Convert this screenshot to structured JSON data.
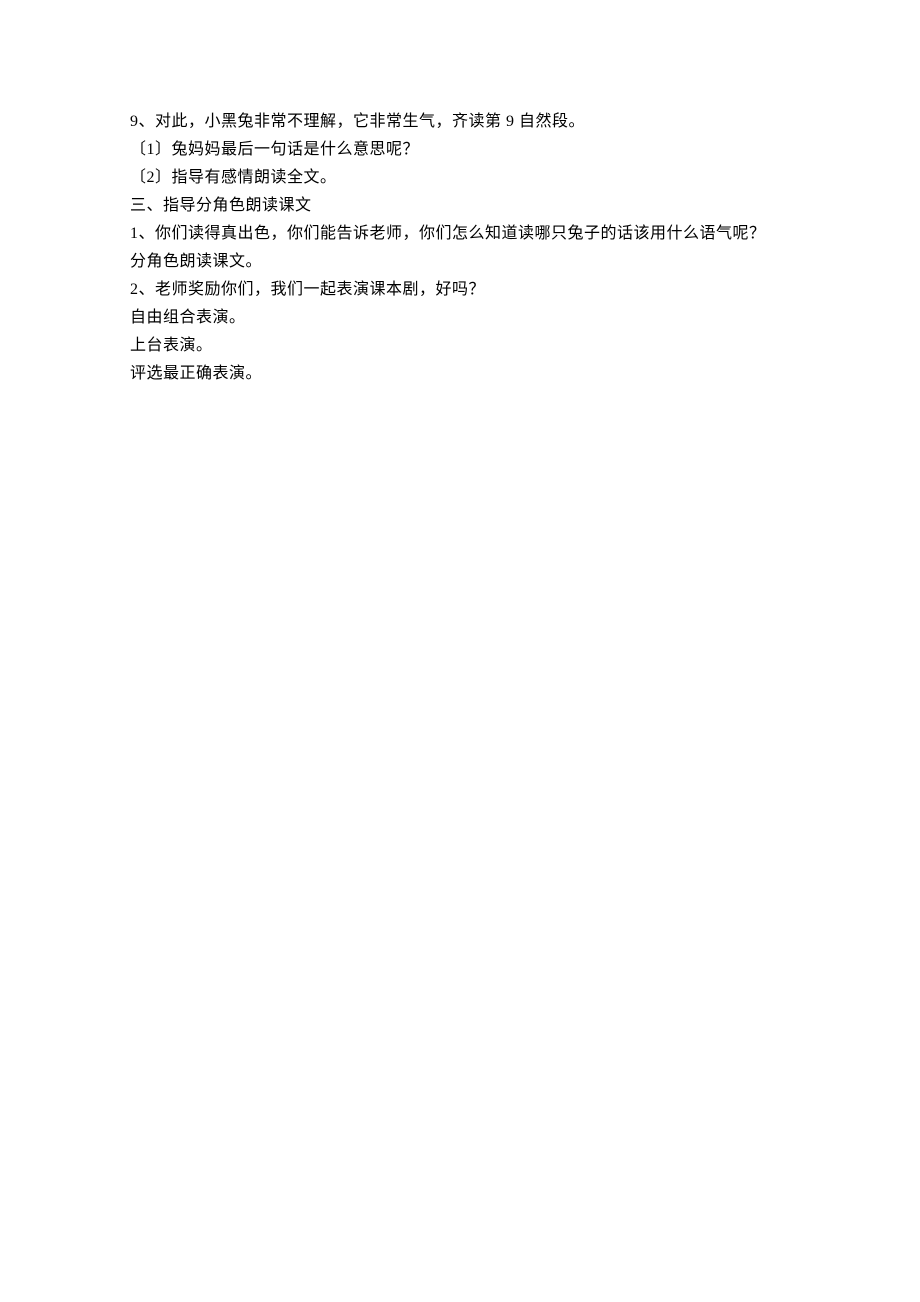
{
  "lines": [
    "9、对此，小黑兔非常不理解，它非常生气，齐读第 9 自然段。",
    "〔1〕兔妈妈最后一句话是什么意思呢？",
    "〔2〕指导有感情朗读全文。",
    "三、指导分角色朗读课文",
    "1、你们读得真出色，你们能告诉老师，你们怎么知道读哪只兔子的话该用什么语气呢？",
    "分角色朗读课文。",
    "2、老师奖励你们，我们一起表演课本剧，好吗？",
    "自由组合表演。",
    "上台表演。",
    "评选最正确表演。"
  ]
}
